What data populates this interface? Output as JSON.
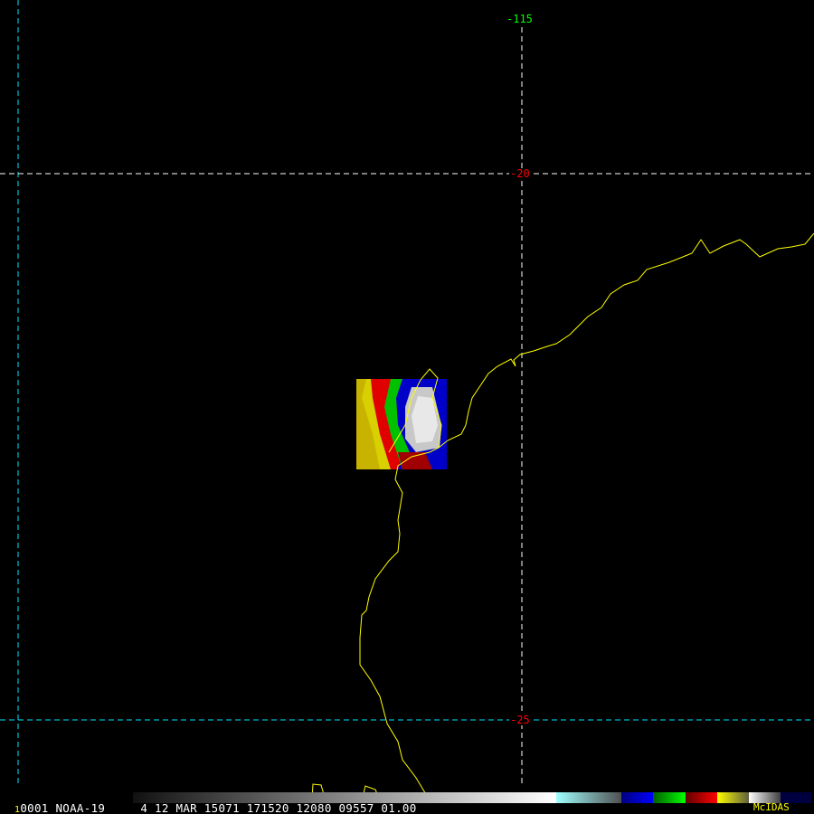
{
  "grid": {
    "lon_label": "-115",
    "lat_labels": [
      "-20",
      "-25"
    ],
    "colors": {
      "lon_label": "#00ff00",
      "lat_label": "#ff0000",
      "cyan_line": "#00e5ff",
      "white_line": "#ffffff",
      "coast": "#ffff00"
    }
  },
  "status_bar": {
    "frame": "1",
    "text": "0001 NOAA-19     4 12 MAR 15071 171520 12080 09557 01.00",
    "brand": "McIDAS"
  },
  "colorbar": {
    "segments": [
      {
        "name": "gray",
        "from": "#111111",
        "to": "#ffffff"
      },
      {
        "name": "cyan",
        "from": "#a0ffff",
        "to": "#505050"
      },
      {
        "name": "blue",
        "from": "#000080",
        "to": "#0000ff"
      },
      {
        "name": "green",
        "from": "#006000",
        "to": "#00ff00"
      },
      {
        "name": "red",
        "from": "#600000",
        "to": "#ff0000"
      },
      {
        "name": "yellow",
        "from": "#ffff00",
        "to": "#606040"
      },
      {
        "name": "white-gray",
        "from": "#ffffff",
        "to": "#404040"
      },
      {
        "name": "navy",
        "from": "#000040",
        "to": "#000040"
      }
    ]
  }
}
